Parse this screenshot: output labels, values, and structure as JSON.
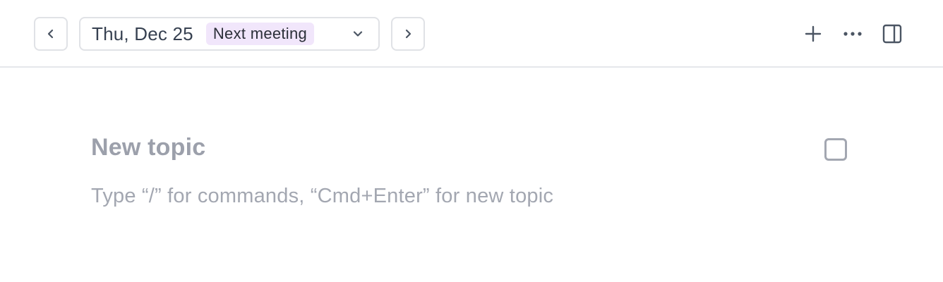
{
  "header": {
    "date": "Thu, Dec 25",
    "badge": "Next meeting",
    "icons": {
      "prev": "chevron-left-icon",
      "next": "chevron-right-icon",
      "dropdown": "chevron-down-icon",
      "add": "plus-icon",
      "more": "ellipsis-icon",
      "panel": "sidebar-panel-icon"
    }
  },
  "topic": {
    "title_placeholder": "New topic",
    "body_placeholder": "Type “/” for commands, “Cmd+Enter” for new topic"
  },
  "colors": {
    "badge_bg": "#f1e6fb",
    "border": "#e0e2e6",
    "placeholder": "#a3a7b1"
  }
}
